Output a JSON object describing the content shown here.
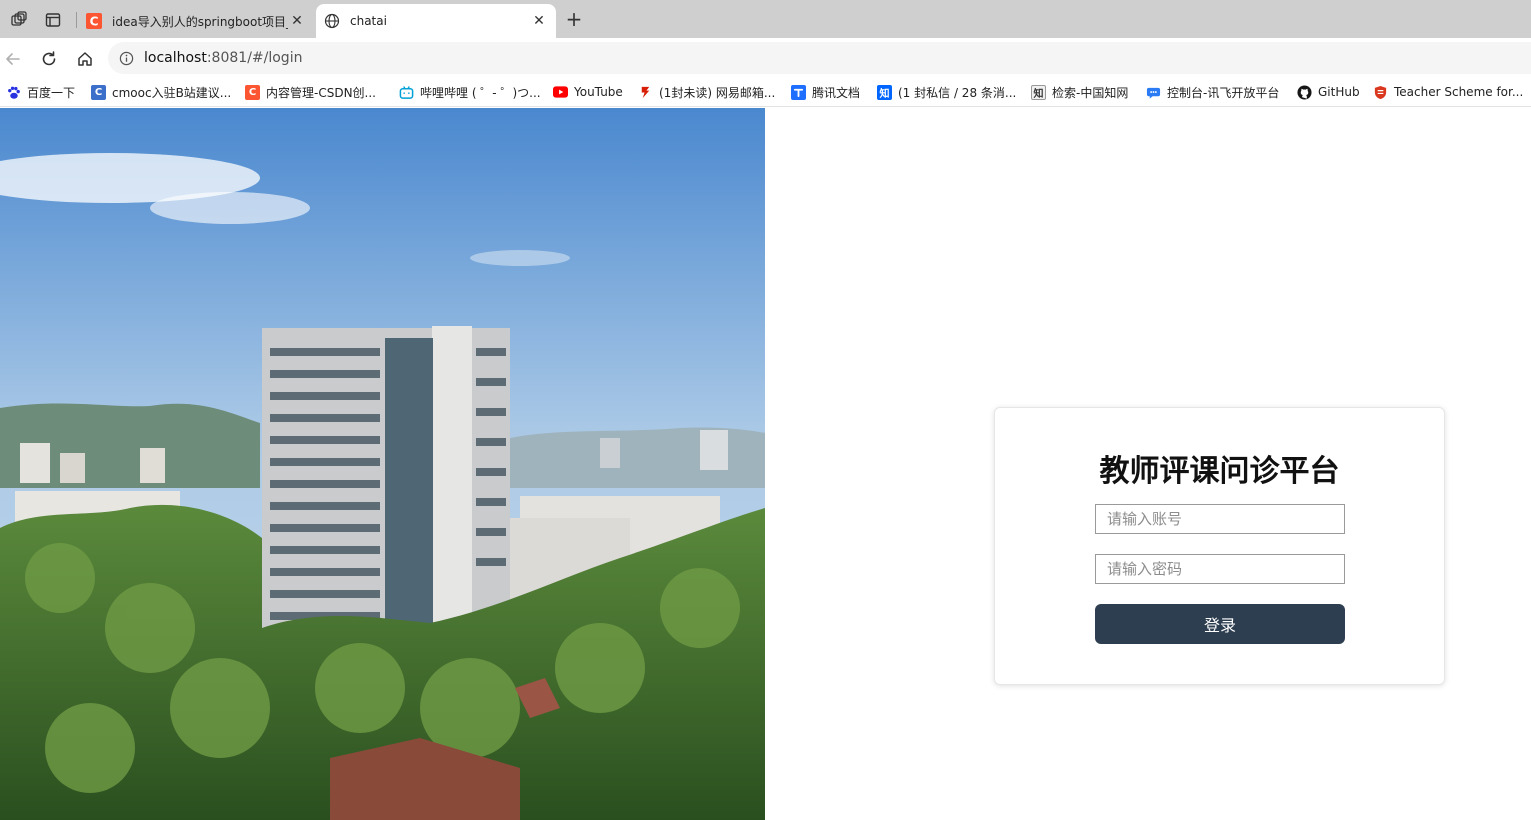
{
  "browser": {
    "tabs": [
      {
        "title": "idea导入别人的springboot项目_ic",
        "favicon_color": "#fc5531",
        "active": false
      },
      {
        "title": "chatai",
        "active": true
      }
    ],
    "address": {
      "host": "localhost",
      "rest": ":8081/#/login"
    },
    "bookmarks": [
      {
        "label": "百度一下",
        "icon": "baidu-paw-icon",
        "color": "#2932e1"
      },
      {
        "label": "cmooc入驻B站建议...",
        "icon": "cmooc-icon",
        "color": "#3b6fc9"
      },
      {
        "label": "内容管理-CSDN创...",
        "icon": "csdn-icon",
        "color": "#fc5531"
      },
      {
        "label": "哔哩哔哩 ( ゜- ゜)つ...",
        "icon": "bilibili-icon",
        "color": "#00a1d6"
      },
      {
        "label": "YouTube",
        "icon": "youtube-icon",
        "color": "#ff0000"
      },
      {
        "label": "(1封未读) 网易邮箱...",
        "icon": "netease-mail-icon",
        "color": "#d81e06"
      },
      {
        "label": "腾讯文档",
        "icon": "tencent-docs-icon",
        "color": "#1e6fff"
      },
      {
        "label": "(1 封私信 / 28 条消...",
        "icon": "zhihu-icon",
        "color": "#0066ff"
      },
      {
        "label": "检索-中国知网",
        "icon": "cnki-icon",
        "color": "#333333"
      },
      {
        "label": "控制台-讯飞开放平台",
        "icon": "iflytek-icon",
        "color": "#2b7bf5"
      },
      {
        "label": "GitHub",
        "icon": "github-icon",
        "color": "#181717"
      },
      {
        "label": "Teacher Scheme for...",
        "icon": "shield-icon",
        "color": "#d9381e"
      }
    ]
  },
  "login": {
    "title": "教师评课问诊平台",
    "account_placeholder": "请输入账号",
    "password_placeholder": "请输入密码",
    "submit_label": "登录"
  },
  "colors": {
    "login_button": "#2c3e50"
  }
}
